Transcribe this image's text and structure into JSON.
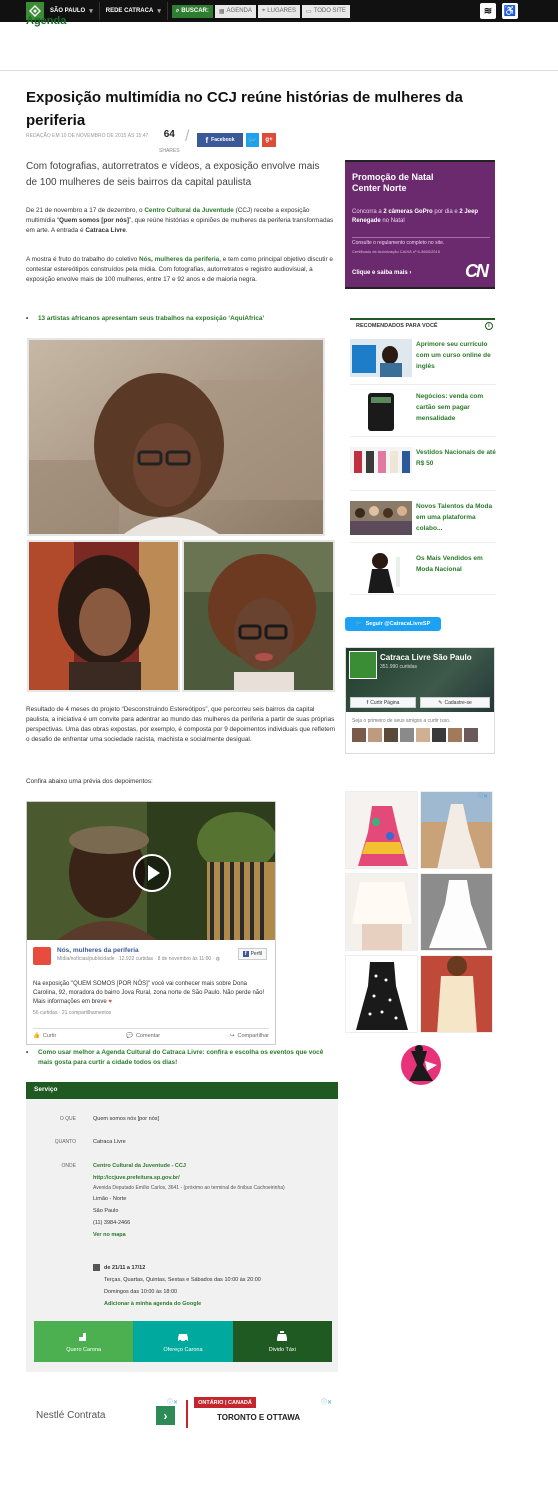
{
  "topbar": {
    "city": "SÃO PAULO",
    "network": "REDE CATRACA",
    "search_label": "BUSCAR:",
    "filters": [
      "AGENDA",
      "LUGARES",
      "TODO SITE"
    ],
    "page_section_peek": "Agenda"
  },
  "article": {
    "title": "Exposição multimídia no CCJ reúne histórias de mulheres da periferia",
    "meta": "REDAÇÃO EM 10 DE NOVEMBRO DE 2015 ÀS 15:47",
    "shares_count": "64",
    "shares_label": "SHARES",
    "share_fb": "Facebook",
    "lead": "Com fotografias, autorretratos e vídeos, a exposição envolve mais de 100 mulheres de seis bairros da capital paulista",
    "p1_a": "De 21 de novembro a 17 de dezembro, o ",
    "p1_b": "Centro Cultural da Juventude",
    "p1_c": " (CCJ) recebe a exposição multimídia “",
    "p1_d": "Quem somos [por nós]",
    "p1_e": "”, que reúne histórias e opiniões de mulheres da periferia transformadas em arte.  A entrada é ",
    "p1_f": "Catraca Livre",
    "p1_g": ".",
    "p2_a": "A mostra é fruto do trabalho do coletivo ",
    "p2_b": "Nós, mulheres da periferia",
    "p2_c": ", e tem como principal objetivo discutir e contestar estereótipos construídos pela mídia. Com fotografias, autorretratos e registro audiovisual, a exposição envolve mais de 100 mulheres, entre 17 e 92 anos e de maioria negra.",
    "bullet1": "13 artistas africanos apresentam seus trabalhos na exposição ‘AquiAfrica’",
    "p3": "Resultado de 4 meses do projeto “Desconstruindo Estereótipos”, que percorreu seis bairros da capital paulista, a iniciativa é um convite para adentrar ao mundo das mulheres da periferia a partir de suas próprias perspectivas. Uma das obras expostas, por exemplo, é composta por 9 depoimentos individuais que refletem o desafio de enfrentar uma sociedade racista, machista e socialmente desigual.",
    "p4": "Confira abaixo uma prévia dos depoimentos:",
    "bullet2": "Como usar melhor a Agenda Cultural do Catraca Livre: confira e escolha os eventos que você mais gosta para curtir a cidade todos os dias!"
  },
  "video_card": {
    "page_name": "Nós, mulheres da periferia",
    "page_sub": "Mídia/notícias/publicidade · 12.922 curtidas · 8 de novembro às 11:00 · ",
    "follow_label": "Perfil",
    "post_text": "Na exposição \"QUEM SOMOS [POR NÓS]\" você vai conhecer mais sobre Dona Carolina, 92, moradora do bairro Jova Rural, zona norte de São Paulo. Não perde não! Mais informações em breve",
    "stats": "56 curtidas · 21 compartilhamentos",
    "actions": [
      "Curtir",
      "Comentar",
      "Compartilhar"
    ]
  },
  "servico": {
    "heading": "Serviço",
    "o_que_label": "O QUE",
    "o_que": "Quem somos nós [por nós]",
    "quanto_label": "QUANTO",
    "quanto": "Catraca Livre",
    "onde_label": "ONDE",
    "venue": "Centro Cultural da Juventude - CCJ",
    "url": "http://ccjuve.prefeitura.sp.gov.br/",
    "address": "Avenida Deputado Emílio Carlos, 3641 - (próximo ao terminal de ônibus Cachoeirinha)",
    "district": "Limão - Norte",
    "city": "São Paulo",
    "phone": "(11) 3984-2466",
    "map_link": "Ver no mapa",
    "dates": "de 21/11 a 17/12",
    "hours1": "Terças, Quartas, Quintas, Sextas e Sábados das 10:00 às 20:00",
    "hours2": "Domingos das 10:00 às 18:00",
    "add_agenda": "Adicionar à minha agenda do Google",
    "buttons": [
      "Quero Carona",
      "Ofereço Carona",
      "Divido Táxi"
    ],
    "button_colors": [
      "#4caf50",
      "#00a99d",
      "#1f5a22"
    ]
  },
  "footer_ad": {
    "label": "Nestlé Contrata",
    "go": "›",
    "banner_top": "ONTÁRIO | CANADÁ",
    "banner_main": "TORONTO E OTTAWA"
  },
  "sidebar": {
    "promo": {
      "title": "Promoção de Natal Center Norte",
      "desc_a": "Concorra a ",
      "desc_b": "2 câmeras GoPro",
      "desc_c": " por dia e ",
      "desc_d": "2 Jeep Renegade",
      "desc_e": " no Natal",
      "rule": "Consulte o regulamento completo no site.",
      "cert": "Certificado de Autorização CAIXA nº 6-3660/2015",
      "cta": "Clique e saiba mais ›",
      "brand": "CN"
    },
    "recommended_heading": "RECOMENDADOS PARA VOCÊ",
    "recommended": [
      "Aprimore seu currículo com um curso online de inglês",
      "Negócios: venda com cartão sem pagar mensalidade",
      "Vestidos Nacionais de até R$ 50",
      "Novos Talentos da Moda em uma plataforma colabo...",
      "Os Mais Vendidos em Moda Nacional"
    ],
    "twitter_follow": "Seguir @CatracaLivreSP",
    "fb_page": {
      "name": "Catraca Livre São Paulo",
      "likes": "351.990 curtidas",
      "like_btn": "Curtir Página",
      "signup_btn": "Cadastre-se",
      "friends": "Seja o primeiro de seus amigos a curtir isso."
    }
  }
}
